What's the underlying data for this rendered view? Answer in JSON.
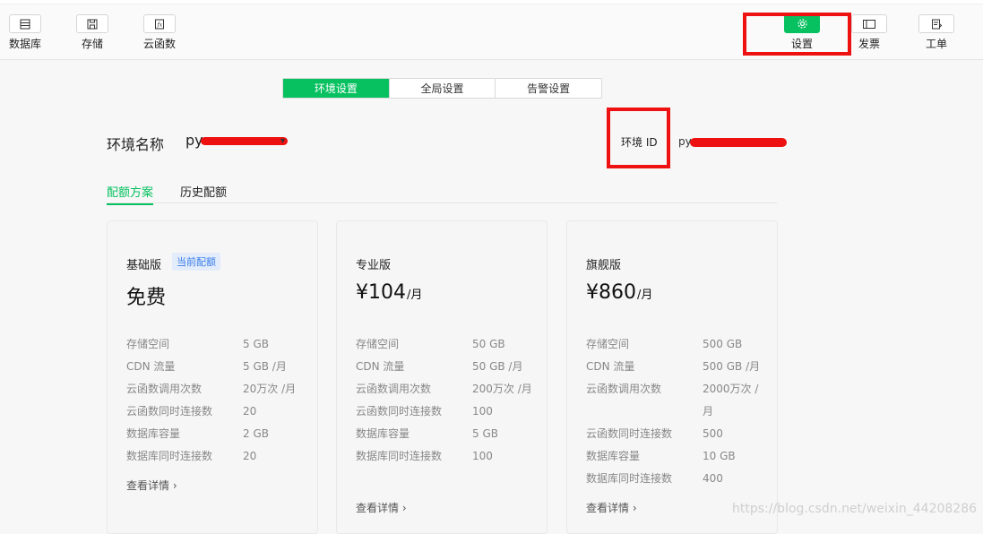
{
  "toolbar": {
    "left": [
      {
        "label": "数据库",
        "icon": "database-icon"
      },
      {
        "label": "存储",
        "icon": "save-icon"
      },
      {
        "label": "云函数",
        "icon": "function-icon"
      }
    ],
    "right": [
      {
        "label": "设置",
        "icon": "gear-icon",
        "active": true
      },
      {
        "label": "发票",
        "icon": "invoice-icon"
      },
      {
        "label": "工单",
        "icon": "ticket-icon"
      }
    ]
  },
  "tabs": [
    "环境设置",
    "全局设置",
    "告警设置"
  ],
  "env": {
    "name_label": "环境名称",
    "name_value": "py",
    "id_label": "环境 ID",
    "id_value": "py"
  },
  "subtabs": [
    "配额方案",
    "历史配额"
  ],
  "plans": [
    {
      "title": "基础版",
      "badge": "当前配额",
      "price": "免费",
      "unit": "",
      "rows": [
        {
          "k": "存储空间",
          "v": "5 GB"
        },
        {
          "k": "CDN 流量",
          "v": "5 GB /月"
        },
        {
          "k": "云函数调用次数",
          "v": "20万次 /月"
        },
        {
          "k": "云函数同时连接数",
          "v": "20"
        },
        {
          "k": "数据库容量",
          "v": "2 GB"
        },
        {
          "k": "数据库同时连接数",
          "v": "20"
        }
      ],
      "more": "查看详情 ›"
    },
    {
      "title": "专业版",
      "badge": "",
      "price": "¥104",
      "unit": "/月",
      "rows": [
        {
          "k": "存储空间",
          "v": "50 GB"
        },
        {
          "k": "CDN 流量",
          "v": "50 GB /月"
        },
        {
          "k": "云函数调用次数",
          "v": "200万次 /月"
        },
        {
          "k": "云函数同时连接数",
          "v": "100"
        },
        {
          "k": "数据库容量",
          "v": "5 GB"
        },
        {
          "k": "数据库同时连接数",
          "v": "100"
        }
      ],
      "more": "查看详情 ›"
    },
    {
      "title": "旗舰版",
      "badge": "",
      "price": "¥860",
      "unit": "/月",
      "rows": [
        {
          "k": "存储空间",
          "v": "500 GB"
        },
        {
          "k": "CDN 流量",
          "v": "500 GB /月"
        },
        {
          "k": "云函数调用次数",
          "v": "2000万次 /月"
        },
        {
          "k": "云函数同时连接数",
          "v": "500"
        },
        {
          "k": "数据库容量",
          "v": "10 GB"
        },
        {
          "k": "数据库同时连接数",
          "v": "400"
        }
      ],
      "more": "查看详情 ›"
    }
  ],
  "watermark": "https://blog.csdn.net/weixin_44208286",
  "colors": {
    "accent": "#07c160",
    "highlight": "#ee1111",
    "badge_text": "#3a7ee8"
  }
}
